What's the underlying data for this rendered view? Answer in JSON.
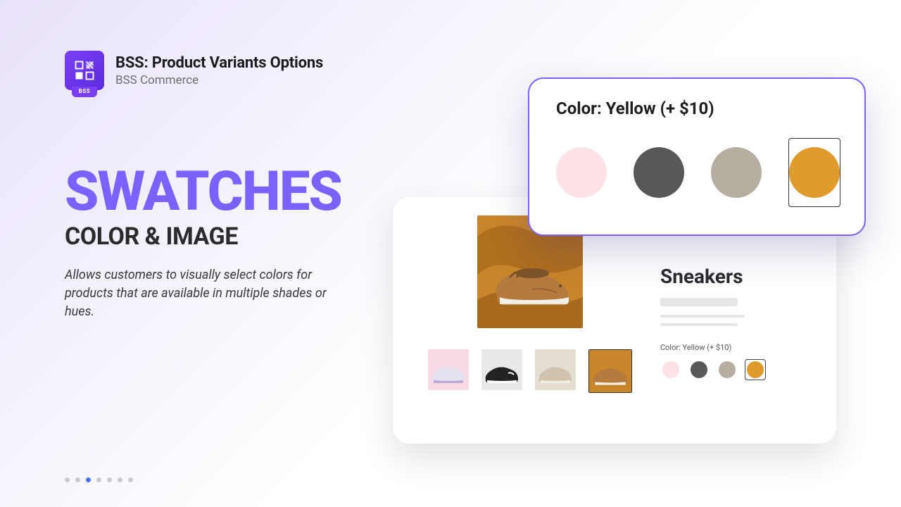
{
  "header": {
    "title": "BSS: Product Variants Options",
    "subtitle": "BSS Commerce",
    "logo_tab": "BSS"
  },
  "copy": {
    "headline": "SWATCHES",
    "subheadline": "COLOR & IMAGE",
    "body": "Allows customers to visually select colors for products that are available in multiple shades or hues."
  },
  "swatch_panel": {
    "label": "Color: Yellow (+ $10)",
    "swatches": [
      {
        "name": "pink",
        "color": "#fde2e8",
        "selected": false
      },
      {
        "name": "gray",
        "color": "#585858",
        "selected": false
      },
      {
        "name": "beige",
        "color": "#b7aea2",
        "selected": false
      },
      {
        "name": "yellow",
        "color": "#e09b2d",
        "selected": true
      }
    ]
  },
  "product": {
    "title": "Sneakers",
    "mini_label": "Color: Yellow (+ $10)",
    "mini_swatches": [
      {
        "name": "pink",
        "color": "#fde2e8",
        "selected": false
      },
      {
        "name": "gray",
        "color": "#585858",
        "selected": false
      },
      {
        "name": "beige",
        "color": "#b7aea2",
        "selected": false
      },
      {
        "name": "yellow",
        "color": "#e09b2d",
        "selected": true
      }
    ],
    "thumbs": [
      {
        "name": "thumb-pink",
        "selected": false
      },
      {
        "name": "thumb-black",
        "selected": false
      },
      {
        "name": "thumb-beige",
        "selected": false
      },
      {
        "name": "thumb-yellow",
        "selected": true
      }
    ]
  },
  "pagination": {
    "total": 7,
    "active_index": 2
  }
}
